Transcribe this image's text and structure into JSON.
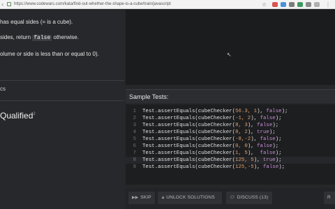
{
  "browser": {
    "url": "https://www.codewars.com/kata/find-out-whether-the-shape-is-a-cube/train/javascript",
    "back_icon": "chevron-left",
    "forward_icon": "chevron-right"
  },
  "description": {
    "line1": "has equal sides (= is a cube).",
    "line2_pre": "sides, return ",
    "line2_code": "false",
    "line2_post": " otherwise.",
    "line3": "olume or side is less than or equal to 0)."
  },
  "tags_label": "cs",
  "qualified": {
    "label": "Qualified",
    "sup": "2"
  },
  "sample_tests": {
    "title": "Sample Tests:",
    "lines": [
      {
        "n": "1",
        "call": "Test.assertEquals(cubeChecker(",
        "args": "56.3, 1",
        "expected": "false",
        "tail": ");"
      },
      {
        "n": "2",
        "call": "Test.assertEquals(cubeChecker(",
        "args": "-1, 2",
        "expected": "false",
        "tail": ");"
      },
      {
        "n": "3",
        "call": "Test.assertEquals(cubeChecker(",
        "args": "8, 3",
        "expected": "false",
        "tail": ");"
      },
      {
        "n": "4",
        "call": "Test.assertEquals(cubeChecker(",
        "args": "8, 2",
        "expected": "true",
        "tail": ");"
      },
      {
        "n": "5",
        "call": "Test.assertEquals(cubeChecker(",
        "args": "-8,-2",
        "expected": "false",
        "tail": ");"
      },
      {
        "n": "6",
        "call": "Test.assertEquals(cubeChecker(",
        "args": "0, 0",
        "expected": "false",
        "tail": ");"
      },
      {
        "n": "7",
        "call": "Test.assertEquals(cubeChecker(",
        "args": "1, 5",
        "expected": " false",
        "tail": ");"
      },
      {
        "n": "8",
        "call": "Test.assertEquals(cubeChecker(",
        "args": "125, 5",
        "expected": "true",
        "tail": ");"
      },
      {
        "n": "9",
        "call": "Test.assertEquals(cubeChecker(",
        "args": "125,-5",
        "expected": "false",
        "tail": ");"
      }
    ],
    "active_line": "8"
  },
  "toolbar": {
    "skip_label": "SKIP",
    "unlock_label": "UNLOCK SOLUTIONS",
    "discuss_label": "DISCUSS (13)",
    "reset_label": "R"
  },
  "colors": {
    "accent": "#e0a06a",
    "keyword": "#c98ed8",
    "panel": "#26282b"
  }
}
